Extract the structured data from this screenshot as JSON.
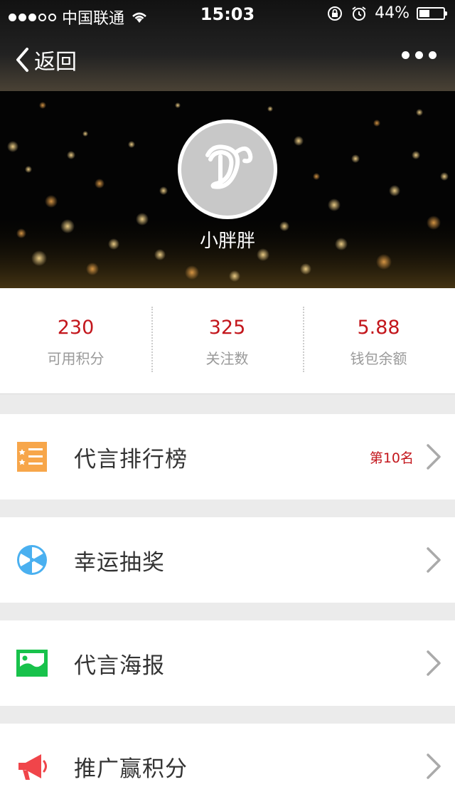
{
  "status_bar": {
    "carrier": "中国联通",
    "time": "15:03",
    "battery_percent": "44%",
    "battery_level": 0.44,
    "signal_bars_filled": 3,
    "signal_bars_total": 5
  },
  "nav": {
    "back_label": "返回",
    "more_icon": "more-dots-icon"
  },
  "profile": {
    "name": "小胖胖",
    "avatar_letter": "D"
  },
  "stats": [
    {
      "value": "230",
      "label": "可用积分"
    },
    {
      "value": "325",
      "label": "关注数"
    },
    {
      "value": "5.88",
      "label": "钱包余额"
    }
  ],
  "menu": [
    {
      "label": "代言排行榜",
      "badge": "第10名",
      "icon": "ranking-list-icon",
      "color": "#f7a64a"
    },
    {
      "label": "幸运抽奖",
      "badge": "",
      "icon": "lottery-wheel-icon",
      "color": "#4ab0f0"
    },
    {
      "label": "代言海报",
      "badge": "",
      "icon": "poster-image-icon",
      "color": "#18c24b"
    },
    {
      "label": "推广赢积分",
      "badge": "",
      "icon": "megaphone-icon",
      "color": "#f0454a"
    }
  ],
  "colors": {
    "accent_red": "#c3161c",
    "background": "#ebebeb"
  }
}
